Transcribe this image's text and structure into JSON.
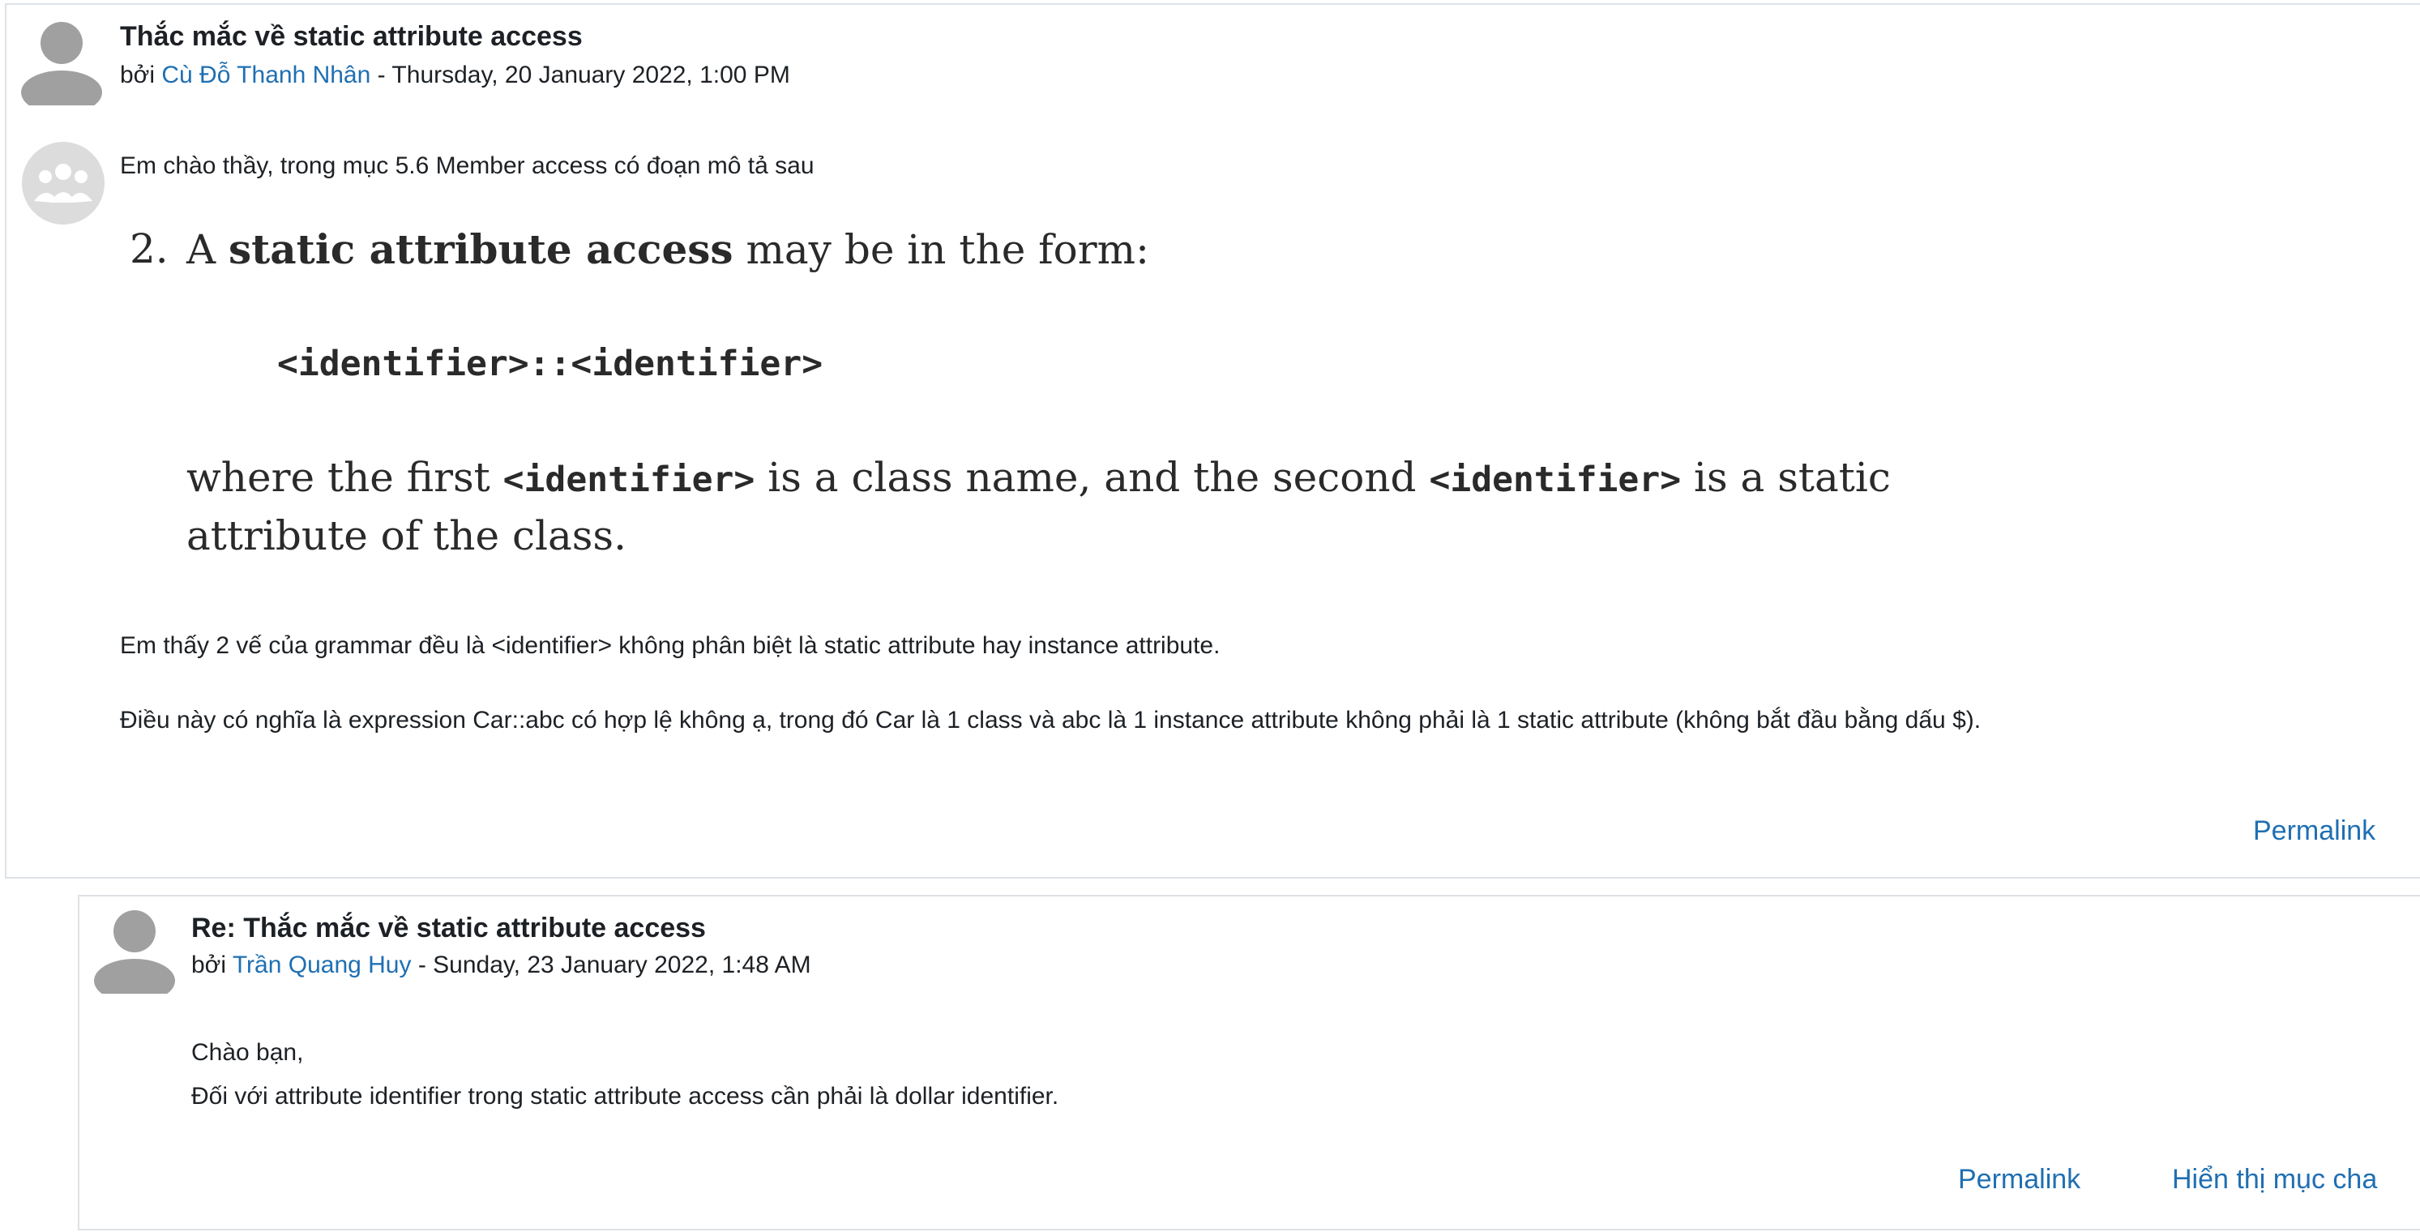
{
  "post1": {
    "subject": "Thắc mắc về static attribute access",
    "by_prefix": "bởi ",
    "author": "Cù Đỗ Thanh Nhân",
    "date": " - Thursday, 20 January 2022, 1:00 PM",
    "intro": "Em chào thầy, trong mục 5.6 Member access có đoạn mô tả sau",
    "excerpt": {
      "number": "2.",
      "lead": "A ",
      "term": "static attribute access",
      "lead_rest": " may be in the form:",
      "code": "<identifier>::<identifier>",
      "where_1": "where the first ",
      "code_1": "<identifier>",
      "where_2": " is a class name, and the second ",
      "code_2": "<identifier>",
      "where_3": " is a static",
      "line2": "attribute of the class."
    },
    "para1": "Em thấy 2 vế của grammar đều là <identifier> không phân biệt là static attribute hay instance attribute.",
    "para2": "Điều này có nghĩa là expression Car::abc có hợp lệ không ạ, trong đó Car là 1 class và abc là 1 instance attribute không phải là 1 static attribute (không bắt đầu bằng dấu $).",
    "permalink": "Permalink"
  },
  "post2": {
    "subject": "Re: Thắc mắc về static attribute access",
    "by_prefix": "bởi ",
    "author": "Trần Quang Huy",
    "date": " - Sunday, 23 January 2022, 1:48 AM",
    "line1": "Chào bạn,",
    "line2": "Đối với attribute identifier trong static attribute access cần phải là dollar identifier.",
    "permalink": "Permalink",
    "show_parent": "Hiển thị mục cha"
  },
  "icons": {
    "user_avatar": "user-avatar-icon",
    "group_avatar": "group-icon"
  }
}
